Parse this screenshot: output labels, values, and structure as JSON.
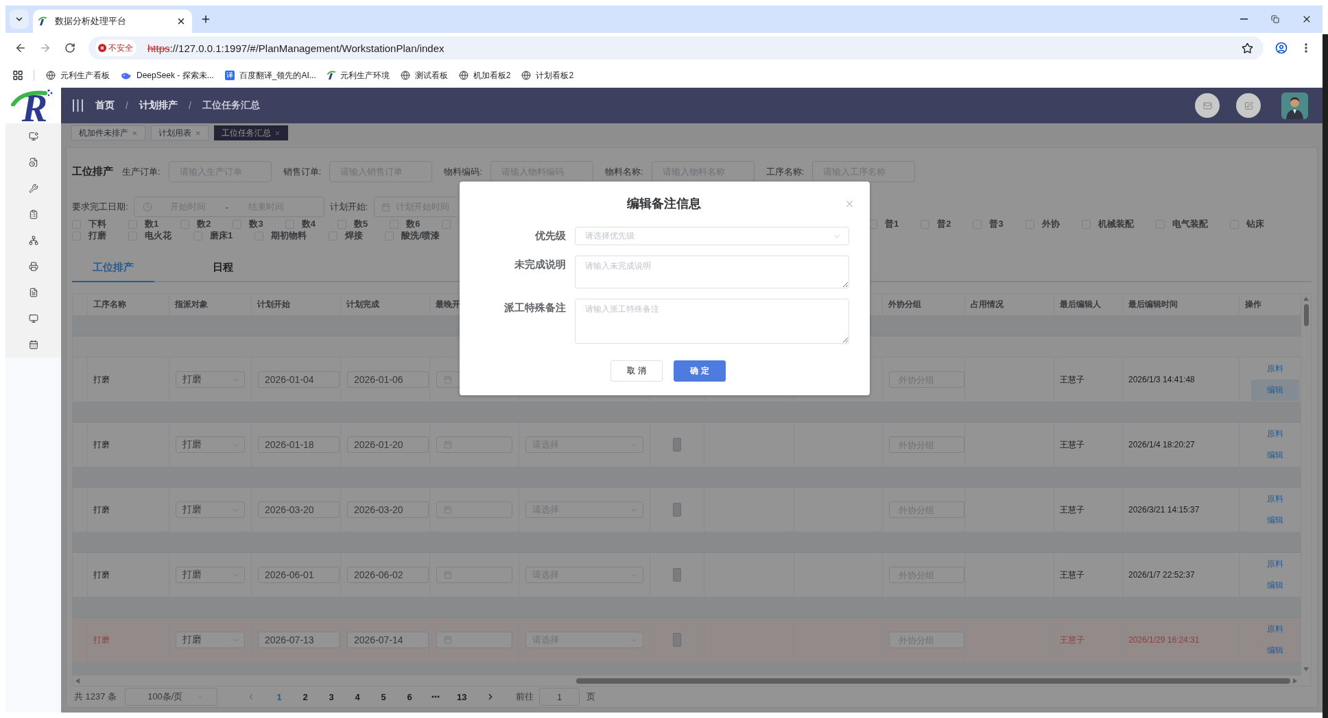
{
  "browser": {
    "tab": {
      "title": "数据分析处理平台"
    },
    "security_label": "不安全",
    "url": {
      "scheme": "https",
      "rest": "://127.0.0.1:1997/#/PlanManagement/WorkstationPlan/index"
    },
    "bookmarks": [
      {
        "kind": "globe",
        "label": "元利生产看板"
      },
      {
        "kind": "whale",
        "label": "DeepSeek - 探索未..."
      },
      {
        "kind": "badge",
        "badge": "译",
        "label": "百度翻译_领先的AI..."
      },
      {
        "kind": "logo",
        "label": "元利生产环境"
      },
      {
        "kind": "globe",
        "label": "测试看板"
      },
      {
        "kind": "globe",
        "label": "机加看板2"
      },
      {
        "kind": "globe",
        "label": "计划看板2"
      }
    ]
  },
  "logo": {
    "letter": "R"
  },
  "header": {
    "breadcrumb": [
      {
        "kind": "link",
        "label": "首页"
      },
      {
        "kind": "separator",
        "label": "/"
      },
      {
        "kind": "link",
        "label": "计划排产"
      },
      {
        "kind": "separator",
        "label": "/"
      },
      {
        "kind": "current",
        "label": "工位任务汇总"
      }
    ]
  },
  "visited_tags": [
    {
      "label": "机加件未排产",
      "selected": false
    },
    {
      "label": "计划用表",
      "selected": false
    },
    {
      "label": "工位任务汇总",
      "selected": true
    }
  ],
  "filters": {
    "title": "工位排产",
    "fields": [
      {
        "label": "生产订单:",
        "placeholder": "请输入生产订单"
      },
      {
        "label": "销售订单:",
        "placeholder": "请输入销售订单"
      },
      {
        "label": "物料编码:",
        "placeholder": "请输入物料编码"
      },
      {
        "label": "物料名称:",
        "placeholder": "请输入物料名称"
      },
      {
        "label": "工序名称:",
        "placeholder": "请输入工序名称"
      }
    ],
    "due_date": {
      "label": "要求完工日期:",
      "start_placeholder": "开始时间",
      "separator": "-",
      "end_placeholder": "结束时间"
    },
    "plan_start": {
      "label": "计划开始:",
      "placeholder": "计划开始时间"
    },
    "checkbox_rows": [
      {
        "segments": [
          [
            {
              "label": "下料",
              "checked": false
            },
            {
              "label": "数1",
              "checked": false
            },
            {
              "label": "数2",
              "checked": false
            },
            {
              "label": "数3",
              "checked": false
            },
            {
              "label": "数4",
              "checked": false
            },
            {
              "label": "数5",
              "checked": false
            },
            {
              "label": "数6",
              "checked": false
            },
            {
              "checked": false
            }
          ],
          [
            {
              "label": "普1",
              "checked": false
            },
            {
              "label": "普2",
              "checked": false
            },
            {
              "label": "普3",
              "checked": false
            },
            {
              "label": "外协",
              "checked": false
            },
            {
              "label": "机械装配",
              "checked": false
            },
            {
              "label": "电气装配",
              "checked": false
            },
            {
              "label": "钻床",
              "checked": false
            }
          ]
        ]
      },
      {
        "segments": [
          [
            {
              "label": "打磨",
              "checked": false
            },
            {
              "label": "电火花",
              "checked": false
            },
            {
              "label": "磨床1",
              "checked": false
            },
            {
              "label": "期初物料",
              "checked": false
            },
            {
              "label": "焊接",
              "checked": false
            },
            {
              "label": "酸洗/喷漆",
              "checked": false
            }
          ]
        ]
      }
    ]
  },
  "view_tabs": [
    {
      "label": "工位排产",
      "selected": true
    },
    {
      "label": "日程",
      "selected": false
    }
  ],
  "table": {
    "columns": [
      "工序名称",
      "指派对象",
      "计划开始",
      "计划完成",
      "最晚开",
      "外协分组",
      "占用情况",
      "最后编辑人",
      "最后编辑时间",
      "操作"
    ],
    "rows": [
      {
        "highlighted": false,
        "process": "打磨",
        "assignee": "打磨",
        "plan_start": "2026-01-04",
        "plan_end": "2026-01-06",
        "group_placeholder": "外协分组",
        "editor": "王慧子",
        "edited_at": "2026/1/3 14:41:48",
        "actions": [
          {
            "label": "原料",
            "hovered": false
          },
          {
            "label": "编辑",
            "hovered": true
          }
        ]
      },
      {
        "highlighted": false,
        "process": "打磨",
        "assignee": "打磨",
        "plan_start": "2026-01-18",
        "plan_end": "2026-01-20",
        "option_placeholder": "请选择",
        "group_placeholder": "外协分组",
        "editor": "王慧子",
        "edited_at": "2026/1/4 18:20:27",
        "actions": [
          {
            "label": "原料",
            "hovered": false
          },
          {
            "label": "编辑",
            "hovered": false
          }
        ]
      },
      {
        "highlighted": false,
        "process": "打磨",
        "assignee": "打磨",
        "plan_start": "2026-03-20",
        "plan_end": "2026-03-20",
        "option_placeholder": "请选择",
        "group_placeholder": "外协分组",
        "editor": "王慧子",
        "edited_at": "2026/3/21 14:15:37",
        "actions": [
          {
            "label": "原料",
            "hovered": false
          },
          {
            "label": "编辑",
            "hovered": false
          }
        ]
      },
      {
        "highlighted": false,
        "process": "打磨",
        "assignee": "打磨",
        "plan_start": "2026-06-01",
        "plan_end": "2026-06-02",
        "option_placeholder": "请选择",
        "group_placeholder": "外协分组",
        "editor": "王慧子",
        "edited_at": "2026/1/7 22:52:37",
        "actions": [
          {
            "label": "原料",
            "hovered": false
          },
          {
            "label": "编辑",
            "hovered": false
          }
        ]
      },
      {
        "highlighted": true,
        "process": "打磨",
        "assignee": "打磨",
        "plan_start": "2026-07-13",
        "plan_end": "2026-07-14",
        "option_placeholder": "请选择",
        "group_placeholder": "外协分组",
        "editor": "王慧子",
        "edited_at": "2026/1/29 16:24:31",
        "actions": [
          {
            "label": "原料",
            "hovered": false
          },
          {
            "label": "编辑",
            "hovered": false
          }
        ]
      }
    ]
  },
  "pagination": {
    "total": "共 1237 条",
    "page_size": "100条/页",
    "pages": [
      {
        "kind": "page",
        "label": "1",
        "selected": true
      },
      {
        "kind": "page",
        "label": "2",
        "selected": false
      },
      {
        "kind": "page",
        "label": "3",
        "selected": false
      },
      {
        "kind": "page",
        "label": "4",
        "selected": false
      },
      {
        "kind": "page",
        "label": "5",
        "selected": false
      },
      {
        "kind": "page",
        "label": "6",
        "selected": false
      },
      {
        "kind": "more",
        "selected": false
      },
      {
        "kind": "page",
        "label": "13",
        "selected": false
      }
    ],
    "goto_label": "前往",
    "goto_value": "1",
    "goto_suffix": "页"
  },
  "dialog": {
    "title": "编辑备注信息",
    "fields": [
      {
        "kind": "select",
        "label": "优先级",
        "placeholder": "请选择优先级"
      },
      {
        "kind": "textarea",
        "label": "未完成说明",
        "placeholder": "请输入未完成说明"
      },
      {
        "kind": "textarea",
        "label": "派工特殊备注",
        "placeholder": "请输入派工特殊备注"
      }
    ],
    "buttons": [
      {
        "kind": "default",
        "label": "取 消"
      },
      {
        "kind": "primary",
        "label": "确 定"
      }
    ]
  }
}
